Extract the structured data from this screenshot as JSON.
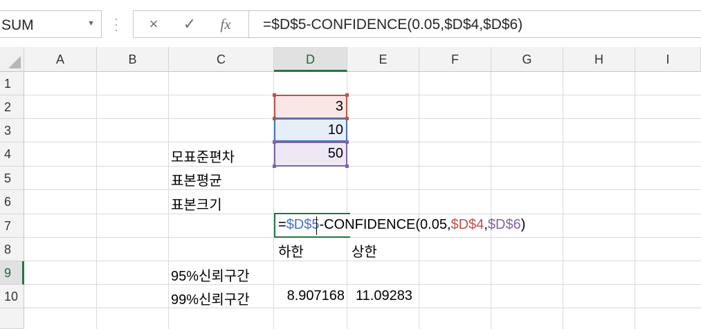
{
  "name_box": {
    "value": "SUM"
  },
  "formula_bar": {
    "cancel_icon": "×",
    "enter_icon": "✓",
    "fx_label": "fx",
    "formula": "=$D$5-CONFIDENCE(0.05,$D$4,$D$6)"
  },
  "columns": [
    "A",
    "B",
    "C",
    "D",
    "E",
    "F",
    "G",
    "H",
    "I"
  ],
  "rows": [
    "1",
    "2",
    "3",
    "4",
    "5",
    "6",
    "7",
    "8",
    "9",
    "10"
  ],
  "selected_column": "D",
  "selected_row": "9",
  "cells": {
    "C4": "모표준편차",
    "D4": "3",
    "C5": "표본평균",
    "D5": "10",
    "C6": "표본크기",
    "D6": "50",
    "D8": "하한",
    "E8": "상한",
    "C9": "95%신뢰구간",
    "C10": "99%신뢰구간",
    "D10": "8.907168",
    "E10": "11.09283"
  },
  "edit_formula": {
    "p1": "=",
    "p2": "$D$5",
    "p3": "-CONFIDENCE(0.05,",
    "p4": "$D$4",
    "p5": ",",
    "p6": "$D$6",
    "p7": ")"
  },
  "colors": {
    "accent": "#217346",
    "ref_blue": "#4472c4",
    "ref_red": "#c0504d",
    "ref_purple": "#8064a2"
  }
}
